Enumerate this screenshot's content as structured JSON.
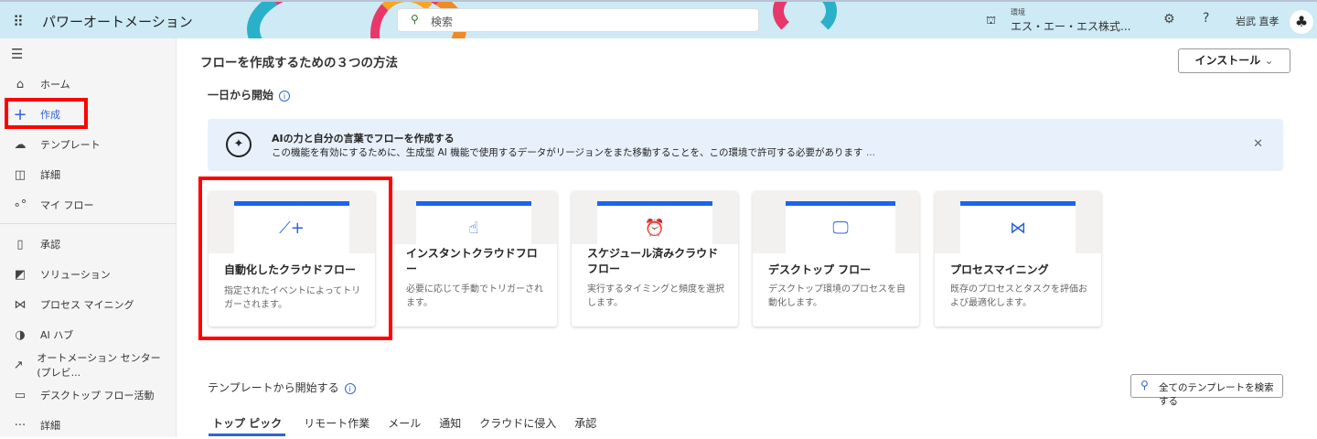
{
  "header": {
    "app_title": "パワーオートメーション",
    "search_placeholder": "検索",
    "env_label": "環境",
    "env_value": "エス・エー・エス株式...",
    "user_name": "岩武 直孝"
  },
  "sidebar": {
    "items": [
      {
        "label": "ホーム",
        "icon": "home-icon"
      },
      {
        "label": "作成",
        "icon": "plus-icon"
      },
      {
        "label": "テンプレート",
        "icon": "template-icon"
      },
      {
        "label": "詳細",
        "icon": "book-icon"
      },
      {
        "label": "マイ フロー",
        "icon": "flow-icon"
      },
      {
        "label": "承認",
        "icon": "approval-icon"
      },
      {
        "label": "ソリューション",
        "icon": "solution-icon"
      },
      {
        "label": "プロセス マイニング",
        "icon": "process-mining-icon"
      },
      {
        "label": "AI ハブ",
        "icon": "ai-hub-icon"
      },
      {
        "label": "オートメーション センター (プレビ...",
        "icon": "chart-icon"
      },
      {
        "label": "デスクトップ フロー活動",
        "icon": "desktop-icon"
      },
      {
        "label": "詳細",
        "icon": "more-icon"
      }
    ]
  },
  "main": {
    "title": "フローを作成するための３つの方法",
    "install_label": "インストール",
    "section_start": "一日から開始",
    "banner": {
      "title": "AIの力と自分の言葉でフローを作成する",
      "desc": "この機能を有効にするために、生成型 AI 機能で使用するデータがリージョンをまた移動することを、この環境で許可する必要があります",
      "link": "..."
    },
    "cards": [
      {
        "title": "自動化したクラウドフロー",
        "desc": "指定されたイベントによってトリガーされます。",
        "icon": "automated-flow-icon"
      },
      {
        "title": "インスタントクラウドフロー",
        "desc": "必要に応じて手動でトリガーされます。",
        "icon": "touch-icon"
      },
      {
        "title": "スケジュール済みクラウドフロー",
        "desc": "実行するタイミングと頻度を選択します。",
        "icon": "alarm-icon"
      },
      {
        "title": "デスクトップ フロー",
        "desc": "デスクトップ環境のプロセスを自動化します。",
        "icon": "desktop-flow-icon"
      },
      {
        "title": "プロセスマイニング",
        "desc": "既存のプロセスとタスクを評価および最適化します。",
        "icon": "process-mining-icon"
      }
    ],
    "templates_heading": "テンプレートから開始する",
    "template_search": "全てのテンプレートを検索する",
    "tabs": [
      "トップ ピック",
      "リモート作業",
      "メール",
      "通知",
      "クラウドに侵入",
      "承認"
    ]
  }
}
